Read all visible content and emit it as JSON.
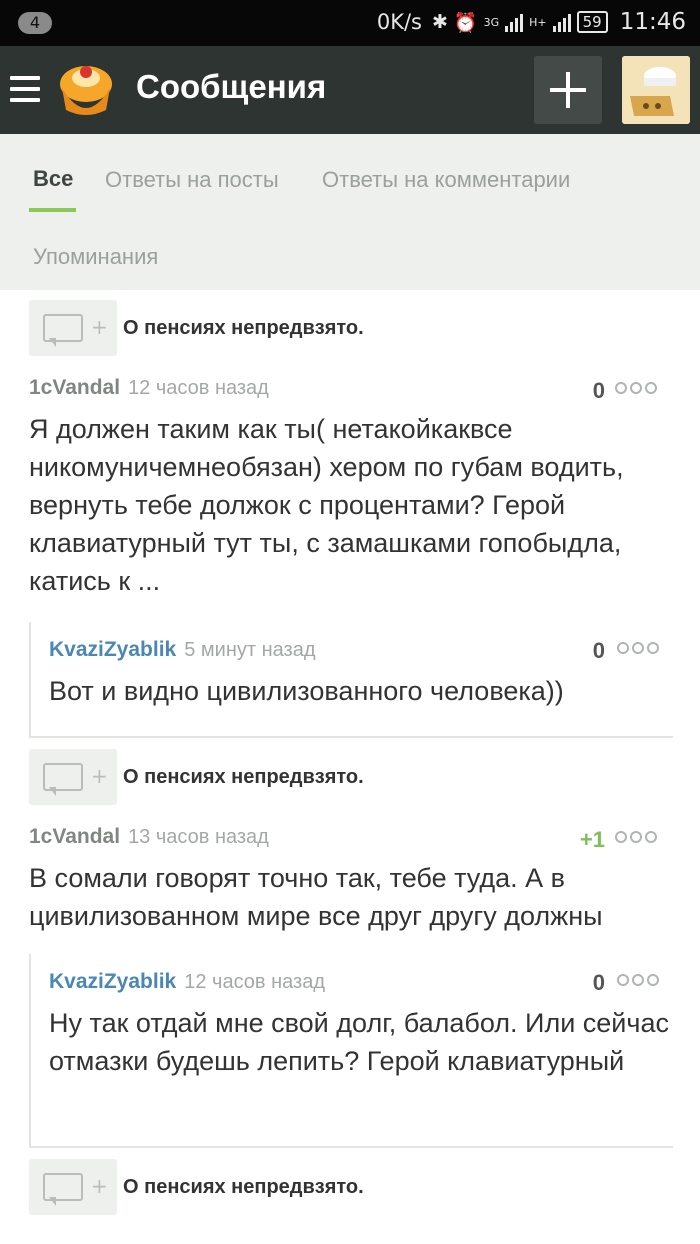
{
  "status_bar": {
    "notifications": "4",
    "speed": "0K/s",
    "network_3g": "3G",
    "network_h": "H+",
    "battery": "59",
    "time": "11:46"
  },
  "header": {
    "title": "Сообщения"
  },
  "tabs": [
    {
      "label": "Все",
      "active": true
    },
    {
      "label": "Ответы на посты",
      "active": false
    },
    {
      "label": "Ответы на комментарии",
      "active": false
    },
    {
      "label": "Упоминания",
      "active": false
    }
  ],
  "threads": [
    {
      "post_title": "О пенсиях непредвзято.",
      "comment": {
        "author": "1cVandal",
        "time": "12 часов назад",
        "rating": "0",
        "text": "Я должен таким как ты( нетакойкаквсе никомуничемнеобязан) хером по губам водить, вернуть тебе должок с процентами? Герой клавиатурный тут ты, с замашками гопобыдла, катись к ..."
      },
      "reply": {
        "author": "KvaziZyablik",
        "time": "5 минут назад",
        "rating": "0",
        "text": "Вот и видно цивилизованного человека))"
      }
    },
    {
      "post_title": "О пенсиях непредвзято.",
      "comment": {
        "author": "1cVandal",
        "time": "13 часов назад",
        "rating": "+1",
        "text": "В сомали говорят точно так, тебе туда. А в цивилизованном мире все друг другу должны"
      },
      "reply": {
        "author": "KvaziZyablik",
        "time": "12 часов назад",
        "rating": "0",
        "text": "Ну так отдай мне свой долг, балабол. Или сейчас отмазки будешь лепить? Герой клавиатурный"
      }
    },
    {
      "post_title": "О пенсиях непредвзято."
    }
  ],
  "colors": {
    "appbar": "#2d3432",
    "accent": "#8ac858",
    "author_blue": "#4b87b5",
    "positive_rating": "#7fbf5a"
  }
}
